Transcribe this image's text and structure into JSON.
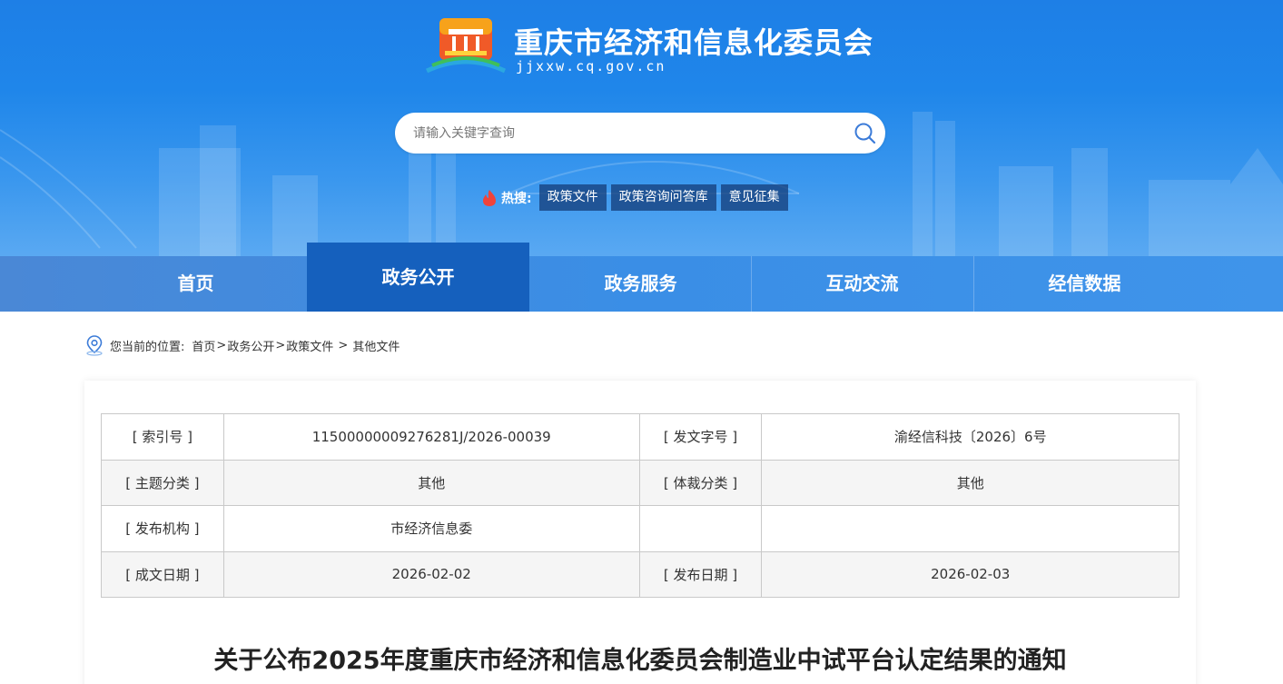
{
  "header": {
    "site_title": "重庆市经济和信息化委员会",
    "site_domain": "jjxxw.cq.gov.cn"
  },
  "search": {
    "placeholder": "请输入关键字查询"
  },
  "hot": {
    "label": "热搜:",
    "tags": [
      "政策文件",
      "政策咨询问答库",
      "意见征集"
    ]
  },
  "nav": {
    "items": [
      "首页",
      "政务公开",
      "政务服务",
      "互动交流",
      "经信数据"
    ],
    "active_index": 1
  },
  "breadcrumb": {
    "prefix": "您当前的位置:",
    "items": [
      "首页",
      "政务公开",
      "政策文件",
      "其他文件"
    ],
    "separators": [
      ">",
      ">",
      " > "
    ]
  },
  "meta_table": {
    "rows": [
      [
        "[ 索引号 ]",
        "11500000009276281J/2026-00039",
        "[ 发文字号 ]",
        "渝经信科技〔2026〕6号"
      ],
      [
        "[ 主题分类 ]",
        "其他",
        "[ 体裁分类 ]",
        "其他"
      ],
      [
        "[ 发布机构 ]",
        "市经济信息委",
        "",
        ""
      ],
      [
        "[ 成文日期 ]",
        "2026-02-02",
        "[ 发布日期 ]",
        "2026-02-03"
      ]
    ]
  },
  "document": {
    "title": "关于公布2025年度重庆市经济和信息化委员会制造业中试平台认定结果的通知"
  },
  "colors": {
    "header_blue": "#1f86ea",
    "nav_active": "#1560bd",
    "hot_tag_bg": "#1b4f8a"
  }
}
